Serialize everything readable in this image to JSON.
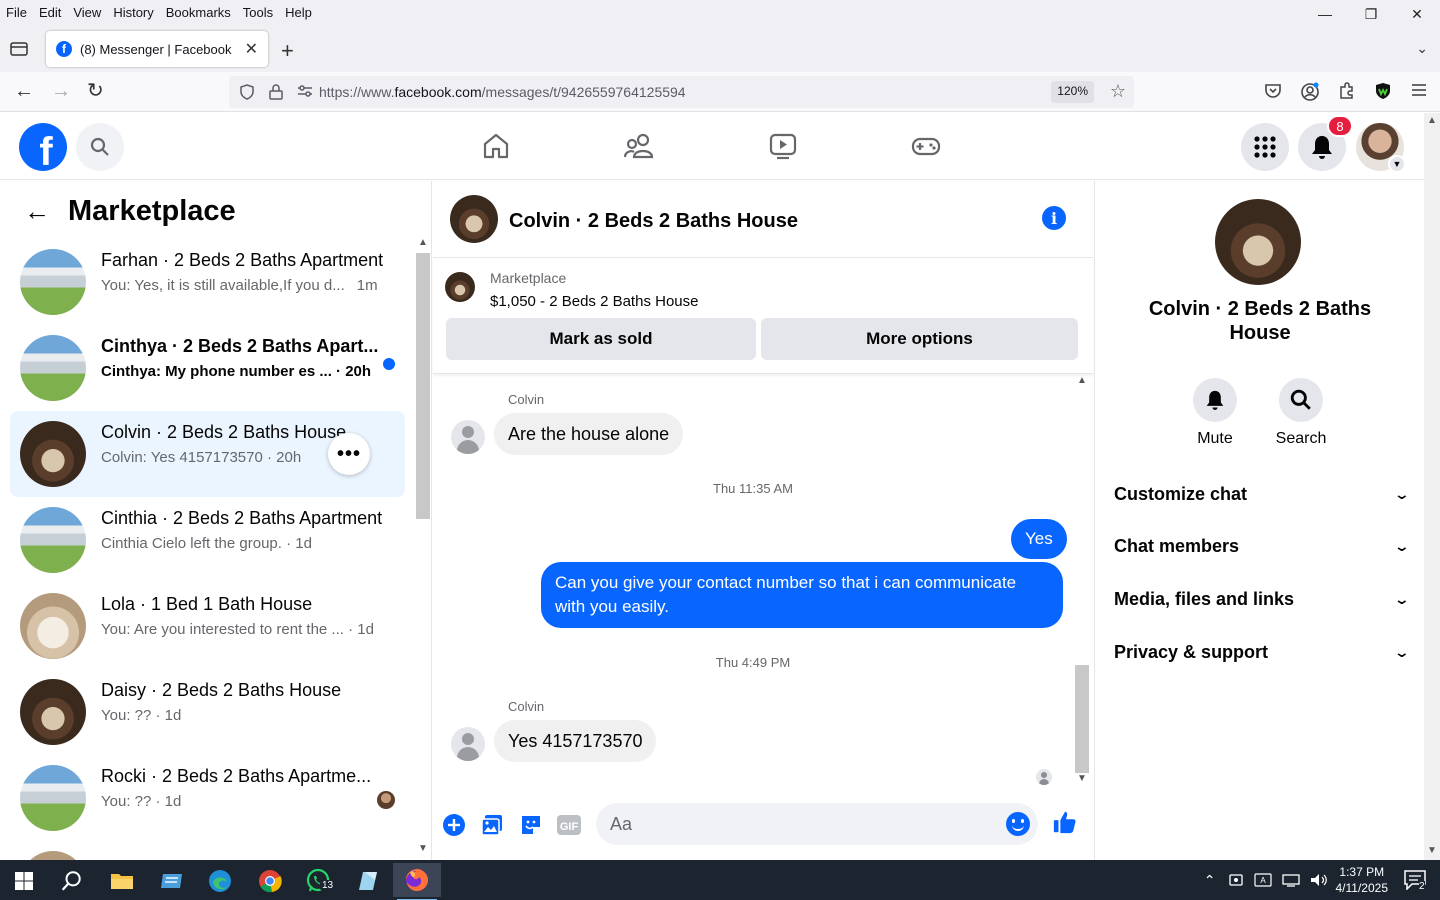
{
  "browser": {
    "menu": [
      "File",
      "Edit",
      "View",
      "History",
      "Bookmarks",
      "Tools",
      "Help"
    ],
    "tab_title": "(8) Messenger | Facebook",
    "url_prefix": "https://www.",
    "url_domain": "facebook.com",
    "url_path": "/messages/t/9426559764125594",
    "zoom": "120%"
  },
  "fb": {
    "notifications_count": "8"
  },
  "left": {
    "title": "Marketplace",
    "conversations": [
      {
        "name": "Farhan · 2 Beds 2 Baths Apartment",
        "snippet": "You: Yes, it is still available,If you d...",
        "time": "1m"
      },
      {
        "name": "Cinthya · 2 Beds 2 Baths Apart...",
        "snippet": "Cinthya: My phone number es ... · 20h"
      },
      {
        "name": "Colvin · 2 Beds 2 Baths House",
        "snippet": "Colvin: Yes 4157173570 · 20h",
        "more": "•••"
      },
      {
        "name": "Cinthia · 2 Beds 2 Baths Apartment",
        "snippet": "Cinthia Cielo left the group. · 1d"
      },
      {
        "name": "Lola · 1 Bed 1 Bath House",
        "snippet": "You: Are you interested to rent the ... · 1d"
      },
      {
        "name": "Daisy · 2 Beds 2 Baths House",
        "snippet": "You: ?? · 1d"
      },
      {
        "name": "Rocki · 2 Beds 2 Baths Apartme...",
        "snippet": "You: ?? · 1d"
      }
    ]
  },
  "chat": {
    "title": "Colvin · 2 Beds 2 Baths House",
    "marketplace_label": "Marketplace",
    "listing": "$1,050 - 2 Beds 2 Baths House",
    "mark_sold": "Mark as sold",
    "more_options": "More options",
    "messages": {
      "sender1": "Colvin",
      "msg1": "Are the house alone",
      "time1": "Thu 11:35 AM",
      "out1": "Yes",
      "out2": "Can you give your contact number so that i can communicate with you easily.",
      "time2": "Thu 4:49 PM",
      "sender2": "Colvin",
      "msg2": "Yes 4157173570"
    },
    "composer_placeholder": "Aa"
  },
  "right": {
    "name": "Colvin · 2 Beds 2 Baths House",
    "mute": "Mute",
    "search": "Search",
    "sections": [
      "Customize chat",
      "Chat members",
      "Media, files and links",
      "Privacy & support"
    ]
  },
  "taskbar": {
    "time": "1:37 PM",
    "date": "4/11/2025",
    "whatsapp_badge": "13",
    "notif_count": "2"
  },
  "colors": {
    "fb_blue": "#0866ff",
    "active_conv": "#ebf5ff",
    "badge_red": "#e41e3f"
  }
}
